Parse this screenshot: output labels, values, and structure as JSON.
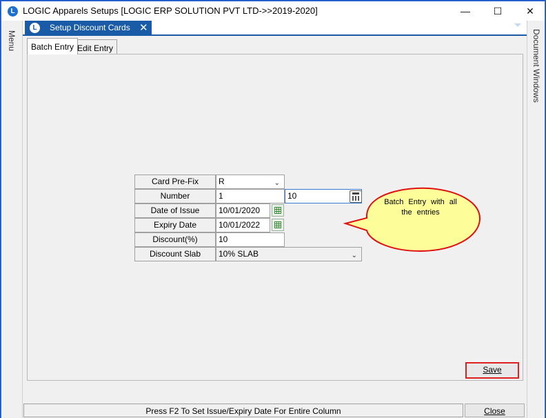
{
  "window": {
    "title": "LOGIC Apparels Setups  [LOGIC ERP SOLUTION PVT LTD->>2019-2020]",
    "app_icon": "L",
    "minimize_glyph": "—",
    "maximize_glyph": "☐",
    "close_glyph": "✕"
  },
  "side_panels": {
    "left_label": "Menu",
    "right_label": "Document Windows"
  },
  "document_tab": {
    "icon": "L",
    "label": "Setup Discount Cards",
    "close_glyph": "✕"
  },
  "tabs": [
    {
      "label": "Batch Entry",
      "active": true
    },
    {
      "label": "Edit Entry",
      "active": false
    }
  ],
  "form": {
    "card_prefix": {
      "label": "Card Pre-Fix",
      "value": "R"
    },
    "number": {
      "label": "Number",
      "from": "1",
      "to": "10"
    },
    "date_of_issue": {
      "label": "Date of Issue",
      "value": "10/01/2020"
    },
    "expiry_date": {
      "label": "Expiry Date",
      "value": "10/01/2022"
    },
    "discount": {
      "label": "Discount(%)",
      "value": "10"
    },
    "discount_slab": {
      "label": "Discount Slab",
      "value": "10% SLAB"
    }
  },
  "callout": {
    "text": "Batch Entry with all the entries",
    "fill": "#fdfd99",
    "border": "#e01010"
  },
  "buttons": {
    "save_label": "Save",
    "close_label": "Close"
  },
  "status_bar": {
    "text": "Press F2 To Set Issue/Expiry Date For Entire Column"
  },
  "colors": {
    "accent": "#1a5ba8",
    "save_border": "#e02020"
  }
}
